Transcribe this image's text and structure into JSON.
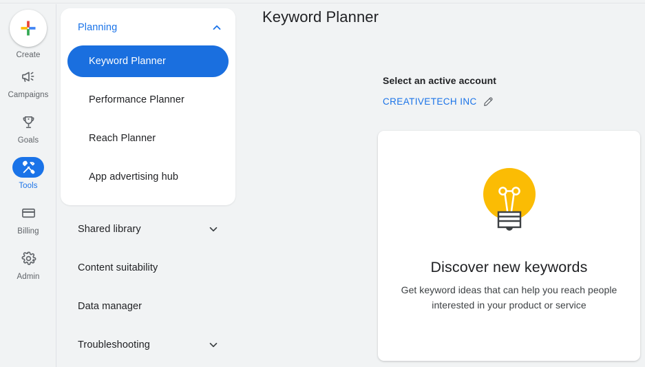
{
  "rail": {
    "items": [
      {
        "label": "Create",
        "icon": "google-plus-icon",
        "active": false
      },
      {
        "label": "Campaigns",
        "icon": "megaphone-icon",
        "active": false
      },
      {
        "label": "Goals",
        "icon": "trophy-icon",
        "active": false
      },
      {
        "label": "Tools",
        "icon": "tools-icon",
        "active": true
      },
      {
        "label": "Billing",
        "icon": "credit-card-icon",
        "active": false
      },
      {
        "label": "Admin",
        "icon": "gear-icon",
        "active": false
      }
    ]
  },
  "nav": {
    "section": {
      "title": "Planning",
      "expanded": true,
      "chevron": "chevron-up-icon",
      "items": [
        {
          "label": "Keyword Planner",
          "selected": true
        },
        {
          "label": "Performance Planner",
          "selected": false
        },
        {
          "label": "Reach Planner",
          "selected": false
        },
        {
          "label": "App advertising hub",
          "selected": false
        }
      ]
    },
    "rows": [
      {
        "label": "Shared library",
        "chevron": "chevron-down-icon"
      },
      {
        "label": "Content suitability",
        "chevron": ""
      },
      {
        "label": "Data manager",
        "chevron": ""
      },
      {
        "label": "Troubleshooting",
        "chevron": "chevron-down-icon"
      }
    ]
  },
  "main": {
    "page_title": "Keyword Planner",
    "account": {
      "label": "Select an active account",
      "name": "CREATIVETECH INC",
      "edit_icon": "pencil-icon"
    },
    "card": {
      "illustration": "lightbulb-icon",
      "heading": "Discover new keywords",
      "subtitle": "Get keyword ideas that can help you reach people interested in your product or service"
    }
  },
  "colors": {
    "accent_blue": "#1a73e8",
    "selected_pill": "#1a6fdf",
    "bulb_amber": "#fbbc04",
    "page_bg": "#f1f3f4",
    "text_primary": "#202124",
    "text_secondary": "#5f6368"
  }
}
